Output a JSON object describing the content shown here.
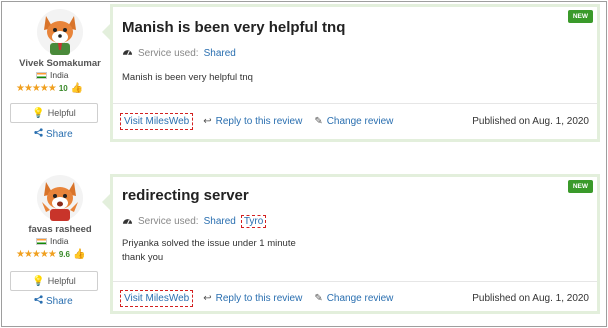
{
  "colors": {
    "accent_green": "#3a9a2a",
    "link_blue": "#2a6fb0",
    "card_border": "#e3efdc",
    "star": "#f0a020"
  },
  "reviews": [
    {
      "user": {
        "name": "Vivek Somakumar",
        "country": "India",
        "score": "10",
        "avatar_icon": "fox-avatar-icon"
      },
      "helpful_label": "Helpful",
      "share_label": "Share",
      "badge": "NEW",
      "title": "Manish is been very helpful tnq",
      "service_label": "Service used:",
      "service_value": "Shared",
      "body": [
        "Manish is been very helpful tnq"
      ],
      "visit_label": "Visit MilesWeb",
      "reply_label": "Reply to this review",
      "change_label": "Change review",
      "published": "Published on Aug. 1, 2020"
    },
    {
      "user": {
        "name": "favas rasheed",
        "country": "India",
        "score": "9.6",
        "avatar_icon": "fox-avatar-icon"
      },
      "helpful_label": "Helpful",
      "share_label": "Share",
      "badge": "NEW",
      "title": "redirecting server",
      "service_label": "Service used:",
      "service_value": "Shared",
      "tag": "Tyro",
      "body": [
        "Priyanka solved the issue under 1 minute",
        "thank you"
      ],
      "visit_label": "Visit MilesWeb",
      "reply_label": "Reply to this review",
      "change_label": "Change review",
      "published": "Published on Aug. 1, 2020"
    }
  ]
}
